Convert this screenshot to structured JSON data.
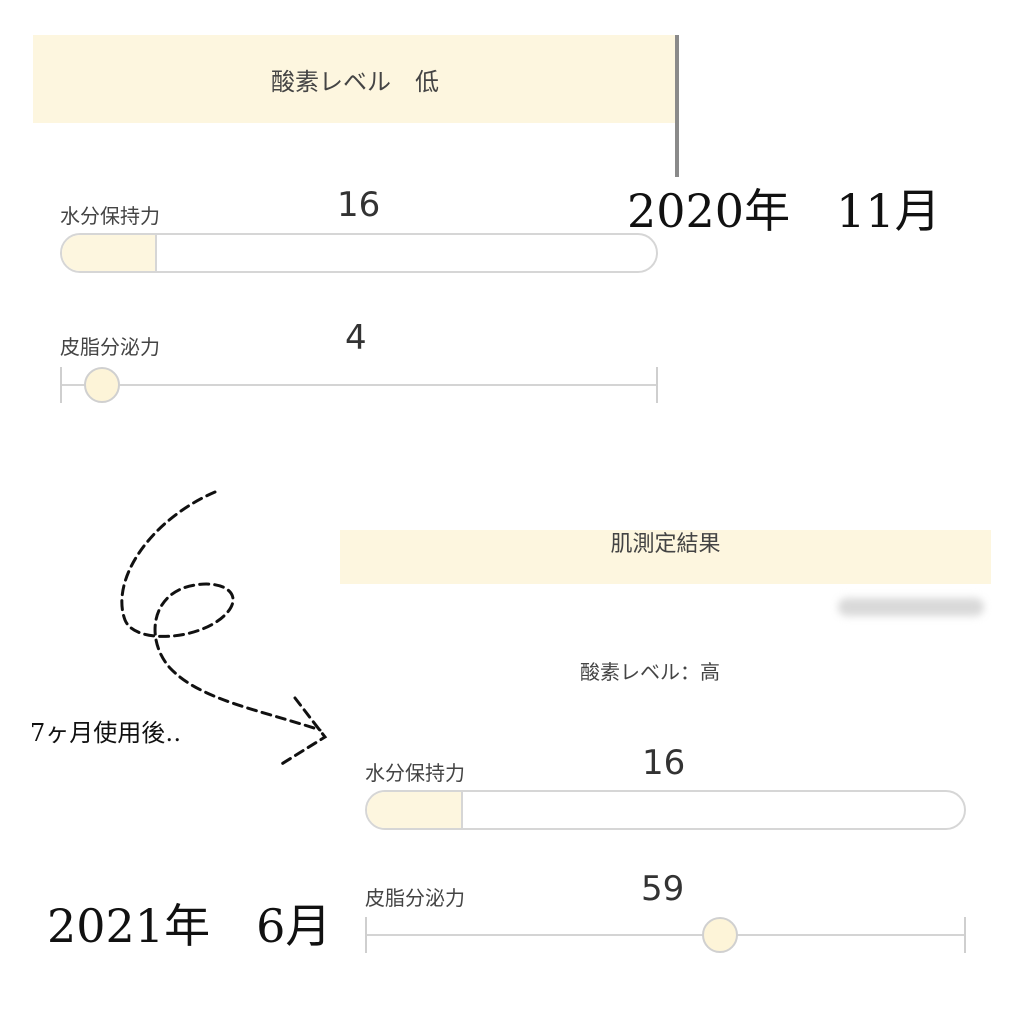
{
  "before": {
    "oxygen_banner": "酸素レベル　低",
    "moisture": {
      "label": "水分保持力",
      "value": "16",
      "level": 0.16
    },
    "sebum": {
      "label": "皮脂分泌力",
      "value": "4",
      "level": 0.04
    },
    "date": "2020年　11月"
  },
  "after": {
    "header": "肌測定結果",
    "oxygen": "酸素レベル：高",
    "moisture": {
      "label": "水分保持力",
      "value": "16",
      "level": 0.16
    },
    "sebum": {
      "label": "皮脂分泌力",
      "value": "59",
      "level": 0.59
    },
    "date": "2021年　6月"
  },
  "annotation": "7ヶ月使用後‥",
  "colors": {
    "banner": "#fdf6df",
    "border": "#d6d6d6",
    "knob": "#fdf4d8"
  }
}
